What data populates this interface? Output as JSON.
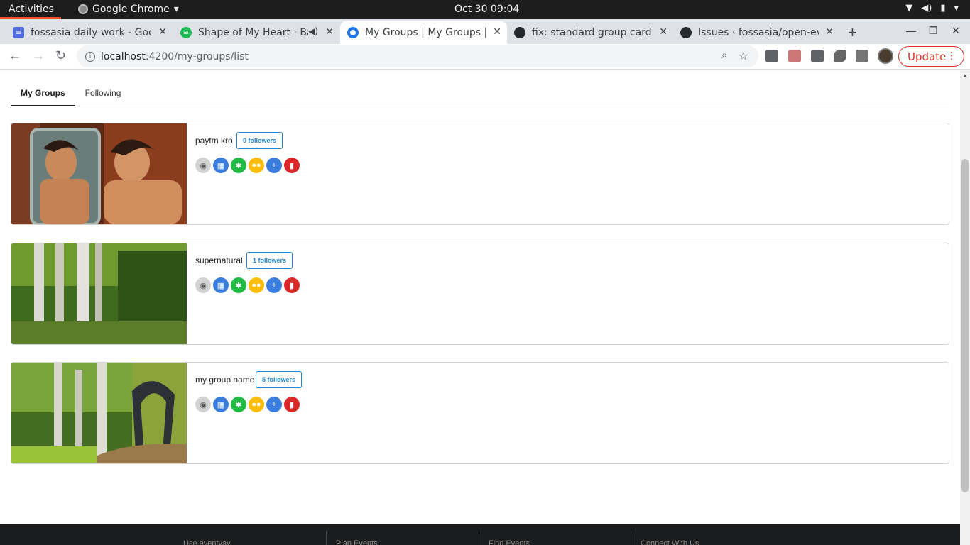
{
  "system": {
    "activities": "Activities",
    "app_name": "Google Chrome",
    "clock": "Oct 30  09:04"
  },
  "tabs": [
    {
      "title": "fossasia daily work - Goog",
      "icon_color": "#4f6cd8"
    },
    {
      "title": "Shape of My Heart · Ba",
      "icon_color": "#1db954"
    },
    {
      "title": "My Groups | My Groups | e",
      "icon_color": "#1a73e8"
    },
    {
      "title": "fix: standard group card ·",
      "icon_color": "#24292e"
    },
    {
      "title": "Issues · fossasia/open-ev",
      "icon_color": "#24292e"
    }
  ],
  "omnibox": {
    "host": "localhost",
    "path": ":4200/my-groups/list"
  },
  "update_label": "Update",
  "page_tabs": {
    "my_groups": "My Groups",
    "following": "Following"
  },
  "groups": [
    {
      "name": "paytm kro",
      "followers": "0 followers"
    },
    {
      "name": "supernatural",
      "followers": "1 followers"
    },
    {
      "name": "my group name",
      "followers": "5 followers"
    }
  ],
  "footer": {
    "col1": "Use eventyay",
    "col2": "Plan Events",
    "col3": "Find Events",
    "col4": "Connect With Us"
  },
  "colors": {
    "view": "#d3d3d3",
    "events": "#3b7ddd",
    "settings": "#21ba45",
    "members": "#fbbd08",
    "add_user": "#3b7ddd",
    "delete": "#db2828"
  }
}
